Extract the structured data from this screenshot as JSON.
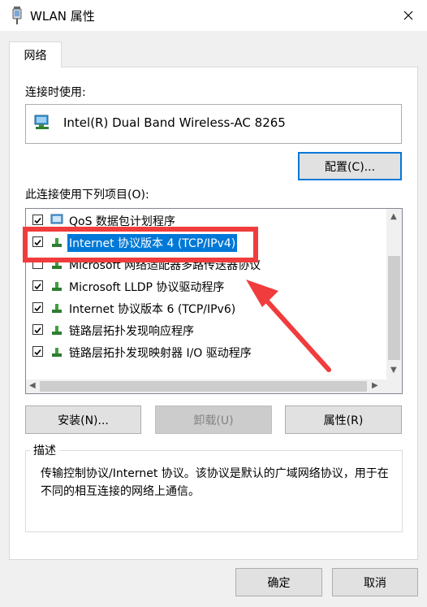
{
  "window": {
    "title": "WLAN 属性"
  },
  "tabs": [
    {
      "label": "网络"
    }
  ],
  "connect_using": {
    "label": "连接时使用:",
    "adapter": "Intel(R) Dual Band Wireless-AC 8265"
  },
  "configure_button": "配置(C)...",
  "items_label": "此连接使用下列项目(O):",
  "items": [
    {
      "label": "QoS 数据包计划程序",
      "checked": true,
      "icon": "qos-icon"
    },
    {
      "label": "Internet 协议版本 4 (TCP/IPv4)",
      "checked": true,
      "selected": true,
      "icon": "protocol-icon"
    },
    {
      "label": "Microsoft 网络适配器多路传送器协议",
      "checked": false,
      "icon": "protocol-icon"
    },
    {
      "label": "Microsoft LLDP 协议驱动程序",
      "checked": true,
      "icon": "protocol-icon"
    },
    {
      "label": "Internet 协议版本 6 (TCP/IPv6)",
      "checked": true,
      "icon": "protocol-icon"
    },
    {
      "label": "链路层拓扑发现响应程序",
      "checked": true,
      "icon": "protocol-icon"
    },
    {
      "label": "链路层拓扑发现映射器 I/O 驱动程序",
      "checked": true,
      "icon": "protocol-icon"
    }
  ],
  "buttons": {
    "install": "安装(N)...",
    "uninstall": "卸载(U)",
    "properties": "属性(R)",
    "ok": "确定",
    "cancel": "取消"
  },
  "description": {
    "title": "描述",
    "text": "传输控制协议/Internet 协议。该协议是默认的广域网络协议，用于在不同的相互连接的网络上通信。"
  },
  "colors": {
    "annotation": "#f03c3c",
    "selection": "#0078d7"
  }
}
